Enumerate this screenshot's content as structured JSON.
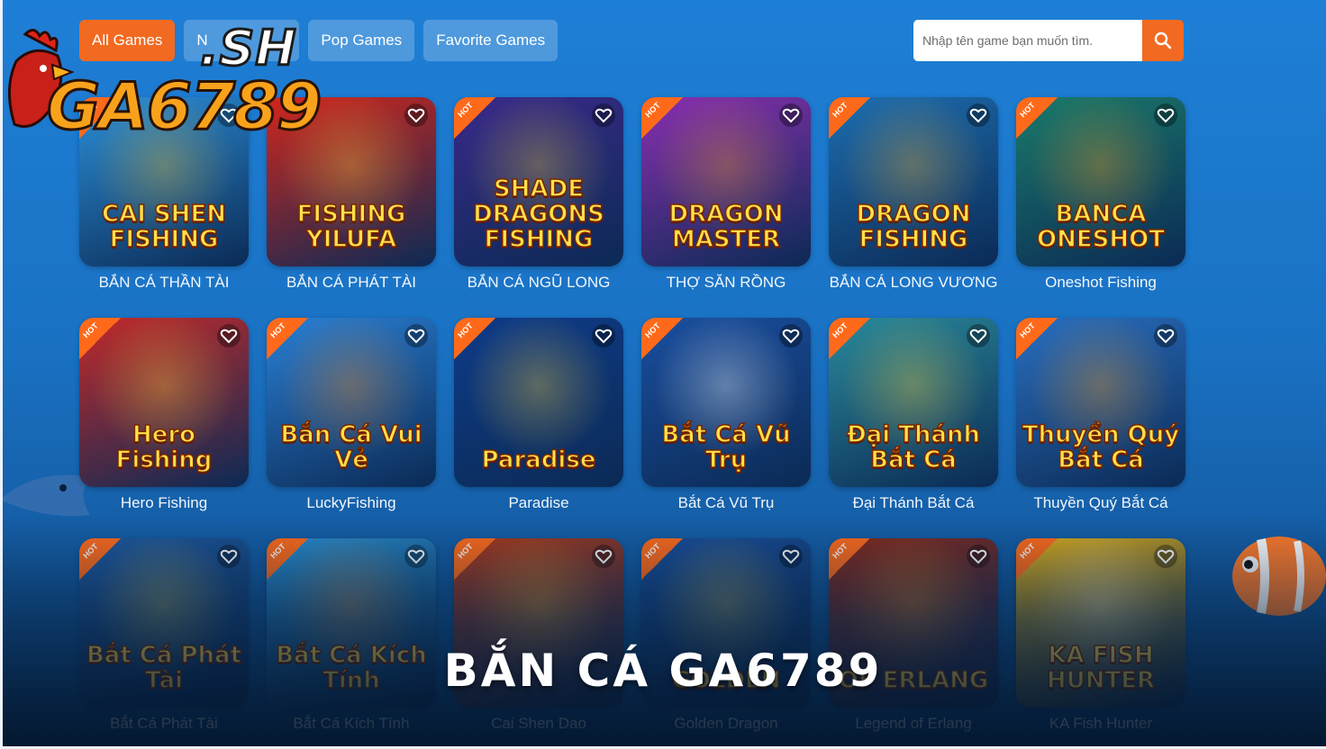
{
  "tabs": [
    {
      "label": "All Games",
      "active": true
    },
    {
      "label": "N",
      "active": false
    },
    {
      "label": "Pop Games",
      "active": false
    },
    {
      "label": "Favorite Games",
      "active": false
    }
  ],
  "search": {
    "placeholder": "Nhập tên game bạn muốn tìm.",
    "icon": "search-icon"
  },
  "logo": {
    "domain_suffix": ".SH",
    "brand": "GA6789"
  },
  "games": [
    {
      "name": "BẮN CÁ THẦN TÀI",
      "art": "CAI SHEN FISHING",
      "hot": true,
      "bg": "#2b8fd8",
      "accent": "#f3c12a"
    },
    {
      "name": "BẮN CÁ PHÁT TÀI",
      "art": "FISHING YILUFA",
      "hot": false,
      "bg": "#d2261c",
      "accent": "#ffcf3a"
    },
    {
      "name": "BẮN CÁ NGŨ LONG",
      "art": "SHADE DRAGONS FISHING",
      "hot": true,
      "bg": "#3a2a8a",
      "accent": "#e6c63a"
    },
    {
      "name": "THỢ SĂN RỒNG",
      "art": "DRAGON MASTER",
      "hot": true,
      "bg": "#8a2fb0",
      "accent": "#f0a020"
    },
    {
      "name": "BẮN CÁ LONG VƯƠNG",
      "art": "DRAGON FISHING",
      "hot": true,
      "bg": "#1d6eb0",
      "accent": "#f5b22a"
    },
    {
      "name": "Oneshot Fishing",
      "art": "BANCA ONESHOT",
      "hot": true,
      "bg": "#1a7a6a",
      "accent": "#ff9f1c"
    },
    {
      "name": "Hero Fishing",
      "art": "Hero Fishing",
      "hot": true,
      "bg": "#c22a2a",
      "accent": "#ffd43a"
    },
    {
      "name": "LuckyFishing",
      "art": "Bắn Cá Vui Vẻ",
      "hot": true,
      "bg": "#2a7fd4",
      "accent": "#ff8c1a"
    },
    {
      "name": "Paradise",
      "art": "Paradise",
      "hot": true,
      "bg": "#0e3c8a",
      "accent": "#ffd43a"
    },
    {
      "name": "Bắt Cá Vũ Trụ",
      "art": "Bắt Cá Vũ Trụ",
      "hot": true,
      "bg": "#1a4fa0",
      "accent": "#ffffff"
    },
    {
      "name": "Đại Thánh Bắt Cá",
      "art": "Đại Thánh Bắt Cá",
      "hot": true,
      "bg": "#2a8a9a",
      "accent": "#ffd43a"
    },
    {
      "name": "Thuyền Quý Bắt Cá",
      "art": "Thuyền Quý Bắt Cá",
      "hot": true,
      "bg": "#2a6fc0",
      "accent": "#ff9f1c"
    },
    {
      "name": "Bắt Cá Phát Tài",
      "art": "Bắt Cá Phát Tài",
      "hot": true,
      "bg": "#1f5aa0",
      "accent": "#ffd43a"
    },
    {
      "name": "Bắt Cá Kích Tính",
      "art": "Bắt Cá Kích Tính",
      "hot": true,
      "bg": "#2a8fd0",
      "accent": "#ff8c1a"
    },
    {
      "name": "Cai Shen Dao",
      "art": "",
      "hot": true,
      "bg": "#b03a1a",
      "accent": "#ffd43a"
    },
    {
      "name": "Golden Dragon",
      "art": "GOLDEN",
      "hot": true,
      "bg": "#1a4f9a",
      "accent": "#ffd43a"
    },
    {
      "name": "Legend of Erlang",
      "art": "OF ERLANG",
      "hot": true,
      "bg": "#8a2a1a",
      "accent": "#ffb02a"
    },
    {
      "name": "KA Fish Hunter",
      "art": "KA FISH HUNTER",
      "hot": true,
      "bg": "#e0b01a",
      "accent": "#ffffff"
    }
  ],
  "banner": "BẮN CÁ GA6789"
}
